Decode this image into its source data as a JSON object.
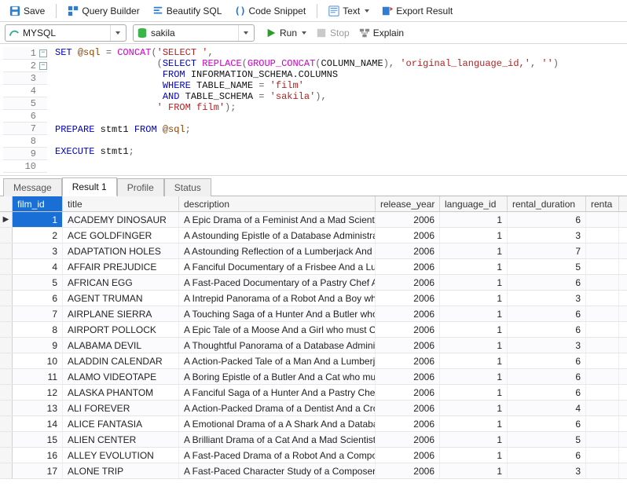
{
  "toolbar": {
    "save": "Save",
    "query_builder": "Query Builder",
    "beautify": "Beautify SQL",
    "code_snippet": "Code Snippet",
    "text": "Text",
    "export": "Export Result"
  },
  "selectors": {
    "engine": "MYSQL",
    "database": "sakila",
    "run": "Run",
    "stop": "Stop",
    "explain": "Explain"
  },
  "editor": {
    "lines": [
      "1",
      "2",
      "3",
      "4",
      "5",
      "6",
      "7",
      "8",
      "9",
      "10"
    ]
  },
  "sql": {
    "l1a": "SET",
    "l1b": "@sql",
    "l1c": "=",
    "l1d": "CONCAT",
    "l1e": "(",
    "l1f": "'SELECT '",
    "l1g": ",",
    "l2a": "(",
    "l2b": "SELECT",
    "l2c": "REPLACE",
    "l2d": "(",
    "l2e": "GROUP_CONCAT",
    "l2f": "(",
    "l2g": "COLUMN_NAME",
    "l2h": "),",
    "l2i": "'original_language_id,'",
    "l2j": ",",
    "l2k": "''",
    "l2l": ")",
    "l3a": "FROM",
    "l3b": "INFORMATION_SCHEMA.COLUMNS",
    "l4a": "WHERE",
    "l4b": "TABLE_NAME",
    "l4c": "=",
    "l4d": "'film'",
    "l5a": "AND",
    "l5b": "TABLE_SCHEMA",
    "l5c": "=",
    "l5d": "'sakila'",
    "l5e": "),",
    "l6a": "' FROM film'",
    "l6b": ");",
    "l8a": "PREPARE",
    "l8b": "stmt1",
    "l8c": "FROM",
    "l8d": "@sql",
    "l8e": ";",
    "l10a": "EXECUTE",
    "l10b": "stmt1",
    "l10c": ";"
  },
  "tabs": {
    "message": "Message",
    "result1": "Result 1",
    "profile": "Profile",
    "status": "Status"
  },
  "grid": {
    "headers": {
      "film_id": "film_id",
      "title": "title",
      "description": "description",
      "release_year": "release_year",
      "language_id": "language_id",
      "rental_duration": "rental_duration",
      "rental_rate": "renta"
    },
    "rows": [
      {
        "film_id": "1",
        "title": "ACADEMY DINOSAUR",
        "description": "A Epic Drama of a Feminist And a Mad Scientist",
        "release_year": "2006",
        "language_id": "1",
        "rental_duration": "6"
      },
      {
        "film_id": "2",
        "title": "ACE GOLDFINGER",
        "description": "A Astounding Epistle of a Database Administrat",
        "release_year": "2006",
        "language_id": "1",
        "rental_duration": "3"
      },
      {
        "film_id": "3",
        "title": "ADAPTATION HOLES",
        "description": "A Astounding Reflection of a Lumberjack And a",
        "release_year": "2006",
        "language_id": "1",
        "rental_duration": "7"
      },
      {
        "film_id": "4",
        "title": "AFFAIR PREJUDICE",
        "description": "A Fanciful Documentary of a Frisbee And a Lum",
        "release_year": "2006",
        "language_id": "1",
        "rental_duration": "5"
      },
      {
        "film_id": "5",
        "title": "AFRICAN EGG",
        "description": "A Fast-Paced Documentary of a Pastry Chef An",
        "release_year": "2006",
        "language_id": "1",
        "rental_duration": "6"
      },
      {
        "film_id": "6",
        "title": "AGENT TRUMAN",
        "description": "A Intrepid Panorama of a Robot And a Boy who",
        "release_year": "2006",
        "language_id": "1",
        "rental_duration": "3"
      },
      {
        "film_id": "7",
        "title": "AIRPLANE SIERRA",
        "description": "A Touching Saga of a Hunter And a Butler who",
        "release_year": "2006",
        "language_id": "1",
        "rental_duration": "6"
      },
      {
        "film_id": "8",
        "title": "AIRPORT POLLOCK",
        "description": "A Epic Tale of a Moose And a Girl who must Co",
        "release_year": "2006",
        "language_id": "1",
        "rental_duration": "6"
      },
      {
        "film_id": "9",
        "title": "ALABAMA DEVIL",
        "description": "A Thoughtful Panorama of a Database Adminis",
        "release_year": "2006",
        "language_id": "1",
        "rental_duration": "3"
      },
      {
        "film_id": "10",
        "title": "ALADDIN CALENDAR",
        "description": "A Action-Packed Tale of a Man And a Lumberja",
        "release_year": "2006",
        "language_id": "1",
        "rental_duration": "6"
      },
      {
        "film_id": "11",
        "title": "ALAMO VIDEOTAPE",
        "description": "A Boring Epistle of a Butler And a Cat who mus",
        "release_year": "2006",
        "language_id": "1",
        "rental_duration": "6"
      },
      {
        "film_id": "12",
        "title": "ALASKA PHANTOM",
        "description": "A Fanciful Saga of a Hunter And a Pastry Chef v",
        "release_year": "2006",
        "language_id": "1",
        "rental_duration": "6"
      },
      {
        "film_id": "13",
        "title": "ALI FOREVER",
        "description": "A Action-Packed Drama of a Dentist And a Cro",
        "release_year": "2006",
        "language_id": "1",
        "rental_duration": "4"
      },
      {
        "film_id": "14",
        "title": "ALICE FANTASIA",
        "description": "A Emotional Drama of a A Shark And a Databas",
        "release_year": "2006",
        "language_id": "1",
        "rental_duration": "6"
      },
      {
        "film_id": "15",
        "title": "ALIEN CENTER",
        "description": "A Brilliant Drama of a Cat And a Mad Scientist v",
        "release_year": "2006",
        "language_id": "1",
        "rental_duration": "5"
      },
      {
        "film_id": "16",
        "title": "ALLEY EVOLUTION",
        "description": "A Fast-Paced Drama of a Robot And a Compos",
        "release_year": "2006",
        "language_id": "1",
        "rental_duration": "6"
      },
      {
        "film_id": "17",
        "title": "ALONE TRIP",
        "description": "A Fast-Paced Character Study of a Composer A",
        "release_year": "2006",
        "language_id": "1",
        "rental_duration": "3"
      }
    ]
  }
}
